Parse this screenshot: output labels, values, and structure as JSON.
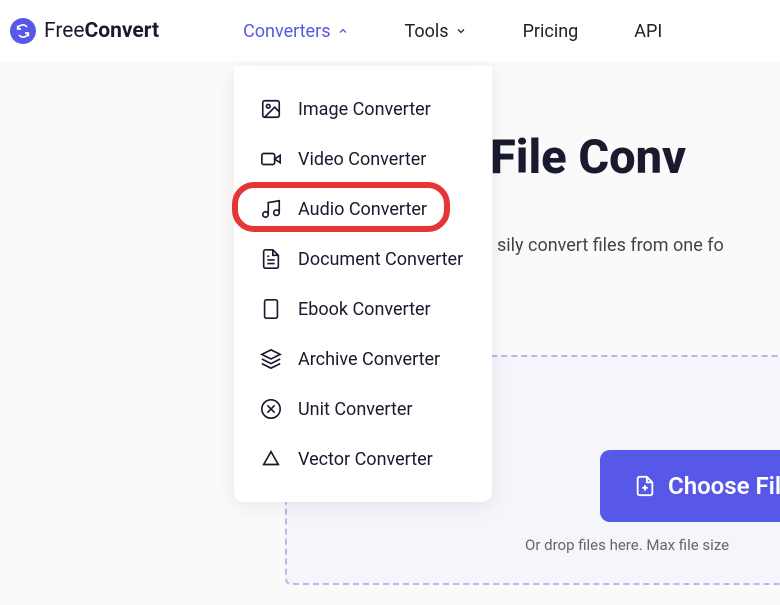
{
  "logo": {
    "part1": "Free",
    "part2": "Convert"
  },
  "nav": {
    "converters": "Converters",
    "tools": "Tools",
    "pricing": "Pricing",
    "api": "API"
  },
  "dropdown": {
    "image": "Image Converter",
    "video": "Video Converter",
    "audio": "Audio Converter",
    "document": "Document Converter",
    "ebook": "Ebook Converter",
    "archive": "Archive Converter",
    "unit": "Unit Converter",
    "vector": "Vector Converter"
  },
  "main": {
    "title": "File Conv",
    "subtitle": "sily convert files from one fo"
  },
  "cta": {
    "choose": "Choose File",
    "drop_text": "Or drop files here. Max file size"
  }
}
